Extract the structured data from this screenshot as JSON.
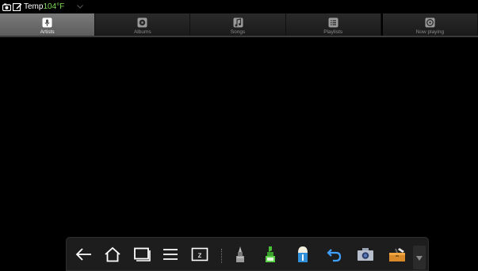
{
  "statusbar": {
    "temp_label": "Temp",
    "temp_value": "104°F",
    "icons": [
      "notification-icon",
      "screenshot-icon",
      "chevron-down-icon"
    ]
  },
  "tabs": [
    {
      "label": "Artists",
      "icon": "microphone-icon",
      "active": true
    },
    {
      "label": "Albums",
      "icon": "album-icon",
      "active": false
    },
    {
      "label": "Songs",
      "icon": "music-note-icon",
      "active": false
    },
    {
      "label": "Playlists",
      "icon": "playlist-icon",
      "active": false
    },
    {
      "label": "Now playing",
      "icon": "now-playing-icon",
      "active": false
    }
  ],
  "dock": {
    "buttons": [
      "back-icon",
      "home-icon",
      "recent-apps-icon",
      "menu-icon",
      "screen-capture-icon",
      "pen-icon",
      "highlighter-icon",
      "eraser-icon",
      "undo-icon",
      "camera-icon",
      "toolbox-icon"
    ],
    "collapse_icon": "triangle-down-icon"
  },
  "colors": {
    "background": "#000000",
    "temp_accent": "#7ed957",
    "active_tab": "#6a6a6a"
  }
}
